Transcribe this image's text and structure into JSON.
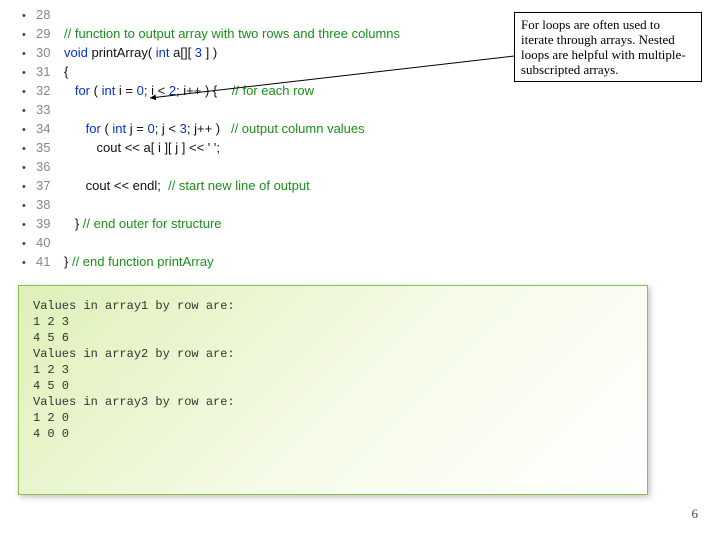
{
  "callout": "For loops are often used to iterate through arrays. Nested loops are helpful with multiple-subscripted arrays.",
  "page_number": "6",
  "code": [
    {
      "n": "28",
      "tokens": []
    },
    {
      "n": "29",
      "tokens": [
        {
          "cls": "c-comment",
          "t": "// function to output array with two rows and three columns"
        }
      ]
    },
    {
      "n": "30",
      "tokens": [
        {
          "cls": "c-keyword",
          "t": "void "
        },
        {
          "cls": "c-plain",
          "t": "printArray( "
        },
        {
          "cls": "c-keyword",
          "t": "int "
        },
        {
          "cls": "c-plain",
          "t": "a[][ "
        },
        {
          "cls": "c-number",
          "t": "3"
        },
        {
          "cls": "c-plain",
          "t": " ] )"
        }
      ]
    },
    {
      "n": "31",
      "tokens": [
        {
          "cls": "c-plain",
          "t": "{"
        }
      ]
    },
    {
      "n": "32",
      "tokens": [
        {
          "cls": "c-plain",
          "t": "   "
        },
        {
          "cls": "c-keyword",
          "t": "for"
        },
        {
          "cls": "c-plain",
          "t": " ( "
        },
        {
          "cls": "c-keyword",
          "t": "int "
        },
        {
          "cls": "c-plain",
          "t": "i = "
        },
        {
          "cls": "c-number",
          "t": "0"
        },
        {
          "cls": "c-plain",
          "t": "; i < "
        },
        {
          "cls": "c-number",
          "t": "2"
        },
        {
          "cls": "c-plain",
          "t": "; i++ ) {    "
        },
        {
          "cls": "c-comment",
          "t": "// for each row"
        }
      ]
    },
    {
      "n": "33",
      "tokens": []
    },
    {
      "n": "34",
      "tokens": [
        {
          "cls": "c-plain",
          "t": "      "
        },
        {
          "cls": "c-keyword",
          "t": "for"
        },
        {
          "cls": "c-plain",
          "t": " ( "
        },
        {
          "cls": "c-keyword",
          "t": "int "
        },
        {
          "cls": "c-plain",
          "t": "j = "
        },
        {
          "cls": "c-number",
          "t": "0"
        },
        {
          "cls": "c-plain",
          "t": "; j < "
        },
        {
          "cls": "c-number",
          "t": "3"
        },
        {
          "cls": "c-plain",
          "t": "; j++ )   "
        },
        {
          "cls": "c-comment",
          "t": "// output column values"
        }
      ]
    },
    {
      "n": "35",
      "tokens": [
        {
          "cls": "c-plain",
          "t": "         cout << a[ i ][ j ] << ' ';"
        }
      ]
    },
    {
      "n": "36",
      "tokens": []
    },
    {
      "n": "37",
      "tokens": [
        {
          "cls": "c-plain",
          "t": "      cout << endl;  "
        },
        {
          "cls": "c-comment",
          "t": "// start new line of output"
        }
      ]
    },
    {
      "n": "38",
      "tokens": []
    },
    {
      "n": "39",
      "tokens": [
        {
          "cls": "c-plain",
          "t": "   } "
        },
        {
          "cls": "c-comment",
          "t": "// end outer for structure"
        }
      ]
    },
    {
      "n": "40",
      "tokens": []
    },
    {
      "n": "41",
      "tokens": [
        {
          "cls": "c-plain",
          "t": "} "
        },
        {
          "cls": "c-comment",
          "t": "// end function printArray"
        }
      ]
    }
  ],
  "output": "Values in array1 by row are:\n1 2 3\n4 5 6\nValues in array2 by row are:\n1 2 3\n4 5 0\nValues in array3 by row are:\n1 2 0\n4 0 0"
}
